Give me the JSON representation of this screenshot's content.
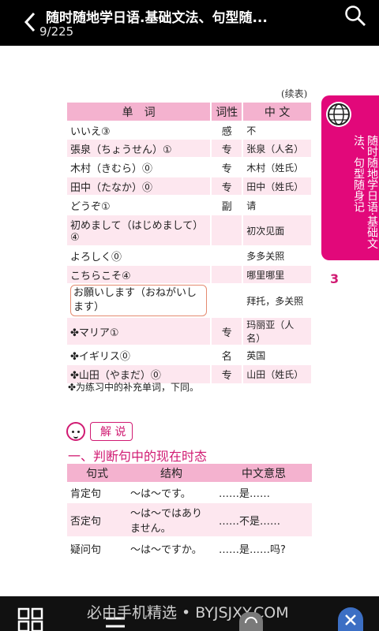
{
  "topbar": {
    "title": "随时随地学日语.基础文法、句型随...",
    "pager": "9/225"
  },
  "page": {
    "continued": "(续表)",
    "vocab_headers": [
      "单　词",
      "词性",
      "中 文"
    ],
    "vocab_rows": [
      {
        "jp": "いいえ③",
        "pos": "感",
        "zh": "不"
      },
      {
        "jp": "張泉（ちょうせん）①",
        "pos": "专",
        "zh": "张泉（人名）"
      },
      {
        "jp": "木村（きむら）⓪",
        "pos": "专",
        "zh": "木村（姓氏）"
      },
      {
        "jp": "田中（たなか）⓪",
        "pos": "专",
        "zh": "田中（姓氏）"
      },
      {
        "jp": "どうぞ①",
        "pos": "副",
        "zh": "请"
      },
      {
        "jp": "初めまして（はじめまして）④",
        "pos": "",
        "zh": "初次见面"
      },
      {
        "jp": "よろしく⓪",
        "pos": "",
        "zh": "多多关照"
      },
      {
        "jp": "こちらこそ④",
        "pos": "",
        "zh": "哪里哪里"
      },
      {
        "jp": "お願いします（おねがいします）",
        "pos": "",
        "zh": "拜托，多关照"
      },
      {
        "jp": "✤マリア①",
        "pos": "专",
        "zh": "玛丽亚（人名）"
      },
      {
        "jp": "✤イギリス⓪",
        "pos": "名",
        "zh": "英国"
      },
      {
        "jp": "✤山田（やまだ）⓪",
        "pos": "专",
        "zh": "山田（姓氏）"
      }
    ],
    "footnote": "✤为练习中的补充单词，下同。",
    "jieshuo": "解 说",
    "heading": "一、判断句中的现在时态",
    "grammar_headers": [
      "句式",
      "结构",
      "中文意思"
    ],
    "grammar_rows": [
      {
        "type": "肯定句",
        "structure": "～は～です。",
        "meaning": "……是……"
      },
      {
        "type": "否定句",
        "structure": "～は～ではありません。",
        "meaning": "……不是……"
      },
      {
        "type": "疑问句",
        "structure": "～は～ですか。",
        "meaning": "……是……吗?"
      }
    ],
    "sidetab_text": "随时随地学日语·基础文法、句型随身记",
    "chapter_num": "3"
  },
  "bottombar": {
    "watermark": "必由手机精选 • BYJSJXY.COM"
  },
  "colors": {
    "accent": "#e2087a",
    "header_pink": "#f4b2cf",
    "row_pink": "#fde7ef"
  }
}
